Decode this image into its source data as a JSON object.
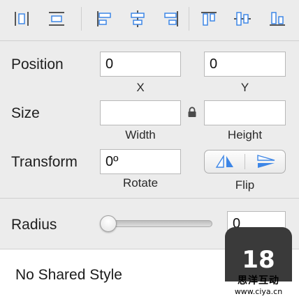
{
  "toolbar": {
    "buttons": [
      {
        "icon": "distribute-horizontal-icon"
      },
      {
        "icon": "distribute-vertical-icon"
      },
      {
        "icon": "align-left-icon"
      },
      {
        "icon": "align-center-horizontal-icon"
      },
      {
        "icon": "align-right-icon"
      },
      {
        "icon": "align-top-icon"
      },
      {
        "icon": "align-middle-vertical-icon"
      },
      {
        "icon": "align-bottom-icon"
      }
    ],
    "accent": "#3d86e6"
  },
  "position": {
    "label": "Position",
    "x_value": "0",
    "x_label": "X",
    "y_value": "0",
    "y_label": "Y"
  },
  "size": {
    "label": "Size",
    "width_value": "",
    "width_label": "Width",
    "height_value": "",
    "height_label": "Height",
    "lock_icon": "lock-icon"
  },
  "transform": {
    "label": "Transform",
    "rotate_value": "0º",
    "rotate_label": "Rotate",
    "flip_label": "Flip"
  },
  "radius": {
    "label": "Radius",
    "value": "0",
    "slider_fraction": 0
  },
  "shared_style": {
    "label": "No Shared Style"
  },
  "watermark": {
    "number": "18",
    "line1": "思洋互动",
    "line2": "www.ciya.cn"
  }
}
